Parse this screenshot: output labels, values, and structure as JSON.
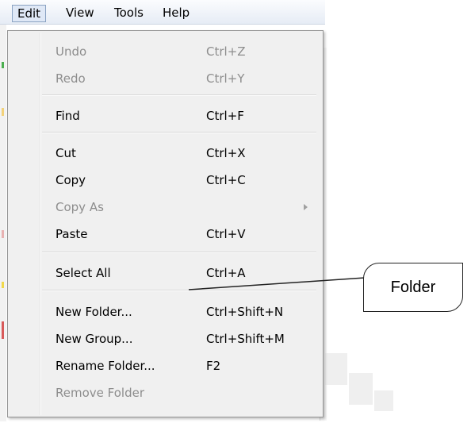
{
  "menubar": {
    "items": [
      "Edit",
      "View",
      "Tools",
      "Help"
    ],
    "active_index": 0
  },
  "menu": {
    "items": [
      {
        "label": "Undo",
        "shortcut": "Ctrl+Z",
        "enabled": false
      },
      {
        "label": "Redo",
        "shortcut": "Ctrl+Y",
        "enabled": false
      },
      {
        "label": "Find",
        "shortcut": "Ctrl+F",
        "enabled": true
      },
      {
        "label": "Cut",
        "shortcut": "Ctrl+X",
        "enabled": true
      },
      {
        "label": "Copy",
        "shortcut": "Ctrl+C",
        "enabled": true
      },
      {
        "label": "Copy As",
        "shortcut": "",
        "enabled": false,
        "submenu": true
      },
      {
        "label": "Paste",
        "shortcut": "Ctrl+V",
        "enabled": true
      },
      {
        "label": "Select All",
        "shortcut": "Ctrl+A",
        "enabled": true
      },
      {
        "label": "New Folder...",
        "shortcut": "Ctrl+Shift+N",
        "enabled": true
      },
      {
        "label": "New Group...",
        "shortcut": "Ctrl+Shift+M",
        "enabled": true
      },
      {
        "label": "Rename Folder...",
        "shortcut": "F2",
        "enabled": true
      },
      {
        "label": "Remove Folder",
        "shortcut": "",
        "enabled": false
      }
    ]
  },
  "callout": {
    "text": "Folder"
  },
  "colors": {
    "menu_bg": "#f0f0f0",
    "disabled_text": "#8d8d8d",
    "menubar_active_border": "#8aa2c2"
  }
}
